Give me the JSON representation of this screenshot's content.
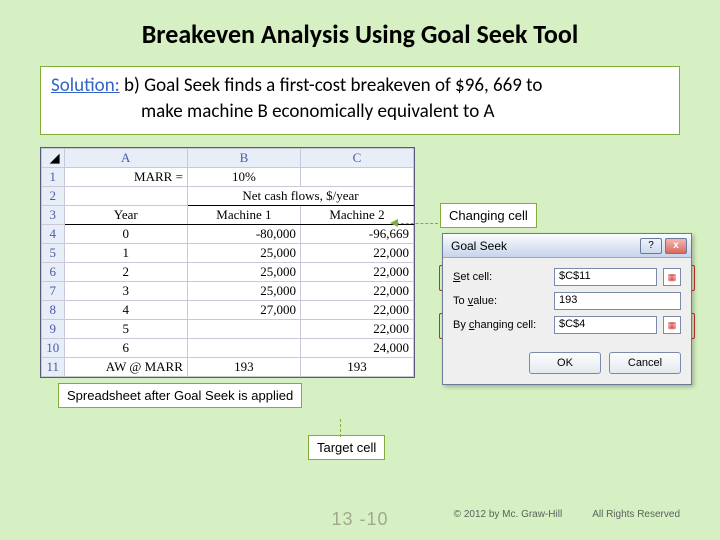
{
  "title": "Breakeven Analysis Using Goal Seek Tool",
  "solution": {
    "label": "Solution:",
    "line1": " b) Goal Seek finds a first-cost breakeven of $96, 669 to",
    "line2": "make machine B economically equivalent to A"
  },
  "annotations": {
    "changing": "Changing cell",
    "applied": "Spreadsheet after Goal Seek is applied",
    "target": "Target cell"
  },
  "sheet": {
    "cols": [
      "A",
      "B",
      "C"
    ],
    "marr_label": "MARR =",
    "marr_value": "10%",
    "ncf_label": "Net cash flows, $/year",
    "year_h": "Year",
    "m1_h": "Machine 1",
    "m2_h": "Machine 2",
    "rows": [
      {
        "n": "4",
        "y": "0",
        "m1": "-80,000",
        "m2": "-96,669"
      },
      {
        "n": "5",
        "y": "1",
        "m1": "25,000",
        "m2": "22,000"
      },
      {
        "n": "6",
        "y": "2",
        "m1": "25,000",
        "m2": "22,000"
      },
      {
        "n": "7",
        "y": "3",
        "m1": "25,000",
        "m2": "22,000"
      },
      {
        "n": "8",
        "y": "4",
        "m1": "27,000",
        "m2": "22,000"
      },
      {
        "n": "9",
        "y": "5",
        "m1": "",
        "m2": "22,000"
      },
      {
        "n": "10",
        "y": "6",
        "m1": "",
        "m2": "24,000"
      }
    ],
    "aw_label": "AW @ MARR",
    "aw_m1": "193",
    "aw_m2": "193"
  },
  "dialog": {
    "title": "Goal Seek",
    "set_cell_l": "Set cell:",
    "set_cell_v": "$C$11",
    "to_value_l": "To value:",
    "to_value_v": "193",
    "by_chg_l": "By changing cell:",
    "by_chg_v": "$C$4",
    "ok": "OK",
    "cancel": "Cancel"
  },
  "footer": {
    "page": "13 -10",
    "copyright": "© 2012 by Mc. Graw-Hill",
    "rights": "All Rights Reserved"
  }
}
